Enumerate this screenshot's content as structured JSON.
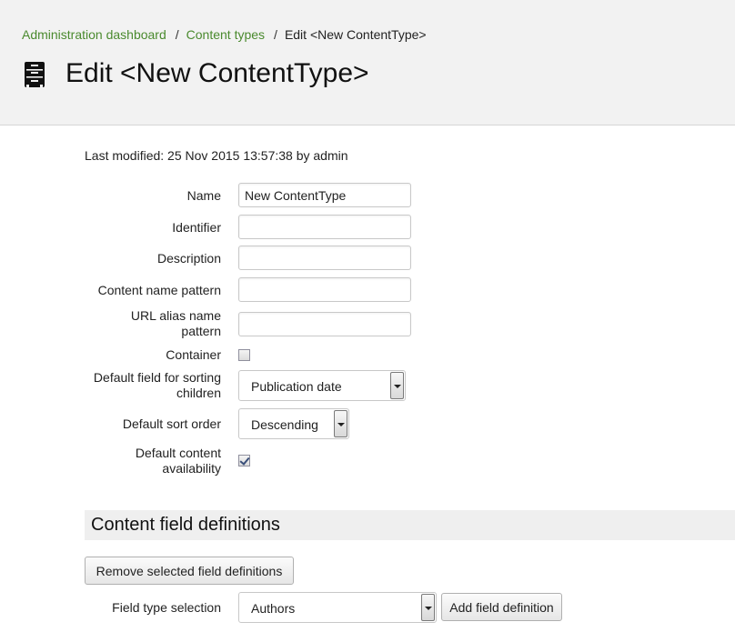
{
  "breadcrumb": {
    "items": [
      "Administration dashboard",
      "Content types"
    ],
    "separator": "/",
    "current": "Edit <New ContentType>"
  },
  "page": {
    "title": "Edit <New ContentType>",
    "icon": "content-type-cabinet-icon",
    "last_modified": "Last modified: 25 Nov 2015 13:57:38 by admin"
  },
  "form": {
    "name": {
      "label": "Name",
      "value": "New ContentType"
    },
    "identifier": {
      "label": "Identifier",
      "value": ""
    },
    "description": {
      "label": "Description",
      "value": ""
    },
    "content_name_pattern": {
      "label": "Content name pattern",
      "value": ""
    },
    "url_alias_line1": "URL alias name",
    "url_alias_line2": "pattern",
    "url_alias_value": "",
    "container": {
      "label": "Container",
      "checked": false
    },
    "sort_field_line1": "Default field for sorting",
    "sort_field_line2": "children",
    "sort_field_value": "Publication date",
    "sort_order": {
      "label": "Default sort order",
      "value": "Descending"
    },
    "availability_line1": "Default content",
    "availability_line2": "availability",
    "availability_checked": true
  },
  "field_definitions": {
    "heading": "Content field definitions",
    "remove_button": "Remove selected field definitions",
    "field_type_label": "Field type selection",
    "field_type_value": "Authors",
    "add_button": "Add field definition"
  },
  "colors": {
    "header_bg": "#f2f2f2",
    "link": "#4a8a2e",
    "section_bg": "#efefef"
  }
}
